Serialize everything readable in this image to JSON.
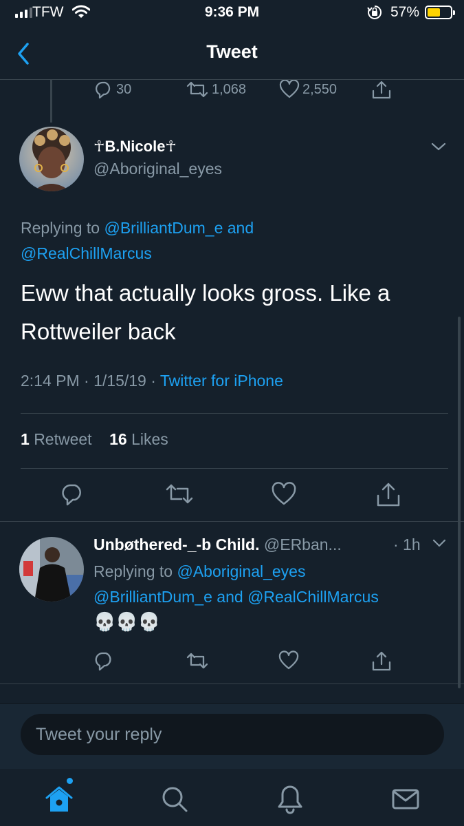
{
  "status_bar": {
    "carrier": "TFW",
    "time": "9:36 PM",
    "battery_percent": "57%",
    "battery_level": 0.57,
    "battery_color": "#ffd400"
  },
  "nav": {
    "title": "Tweet",
    "back_icon": "chevron-left-icon"
  },
  "parent_tweet": {
    "reply_count": "30",
    "retweet_count": "1,068",
    "like_count": "2,550"
  },
  "main_tweet": {
    "display_name": "☥B.Nicole☥",
    "handle": "@Aboriginal_eyes",
    "replying_prefix": "Replying to",
    "replying_to_1": "@BrilliantDum_e",
    "replying_and": "and",
    "replying_to_2": "@RealChillMarcus",
    "text": "Eww that actually looks gross. Like a Rottweiler back",
    "time": "2:14 PM",
    "date": "1/15/19",
    "source": "Twitter for iPhone",
    "retweet_count": "1",
    "retweet_label": "Retweet",
    "like_count": "16",
    "like_label": "Likes"
  },
  "reply_tweet": {
    "display_name": "Unbøthered-_-b Child.",
    "handle": "@ERban...",
    "time": "· 1h",
    "replying_prefix": "Replying to",
    "replying_to_1": "@Aboriginal_eyes",
    "replying_to_2": "@BrilliantDum_e",
    "replying_and": "and",
    "replying_to_3": "@RealChillMarcus",
    "text": "💀💀💀"
  },
  "composer": {
    "placeholder": "Tweet your reply"
  },
  "tab_bar": {
    "items": [
      "home-icon",
      "search-icon",
      "notifications-icon",
      "messages-icon"
    ],
    "active": "home-icon"
  },
  "colors": {
    "background": "#15202b",
    "accent": "#1da1f2",
    "secondary_text": "#8899a6",
    "divider": "#38444d"
  }
}
